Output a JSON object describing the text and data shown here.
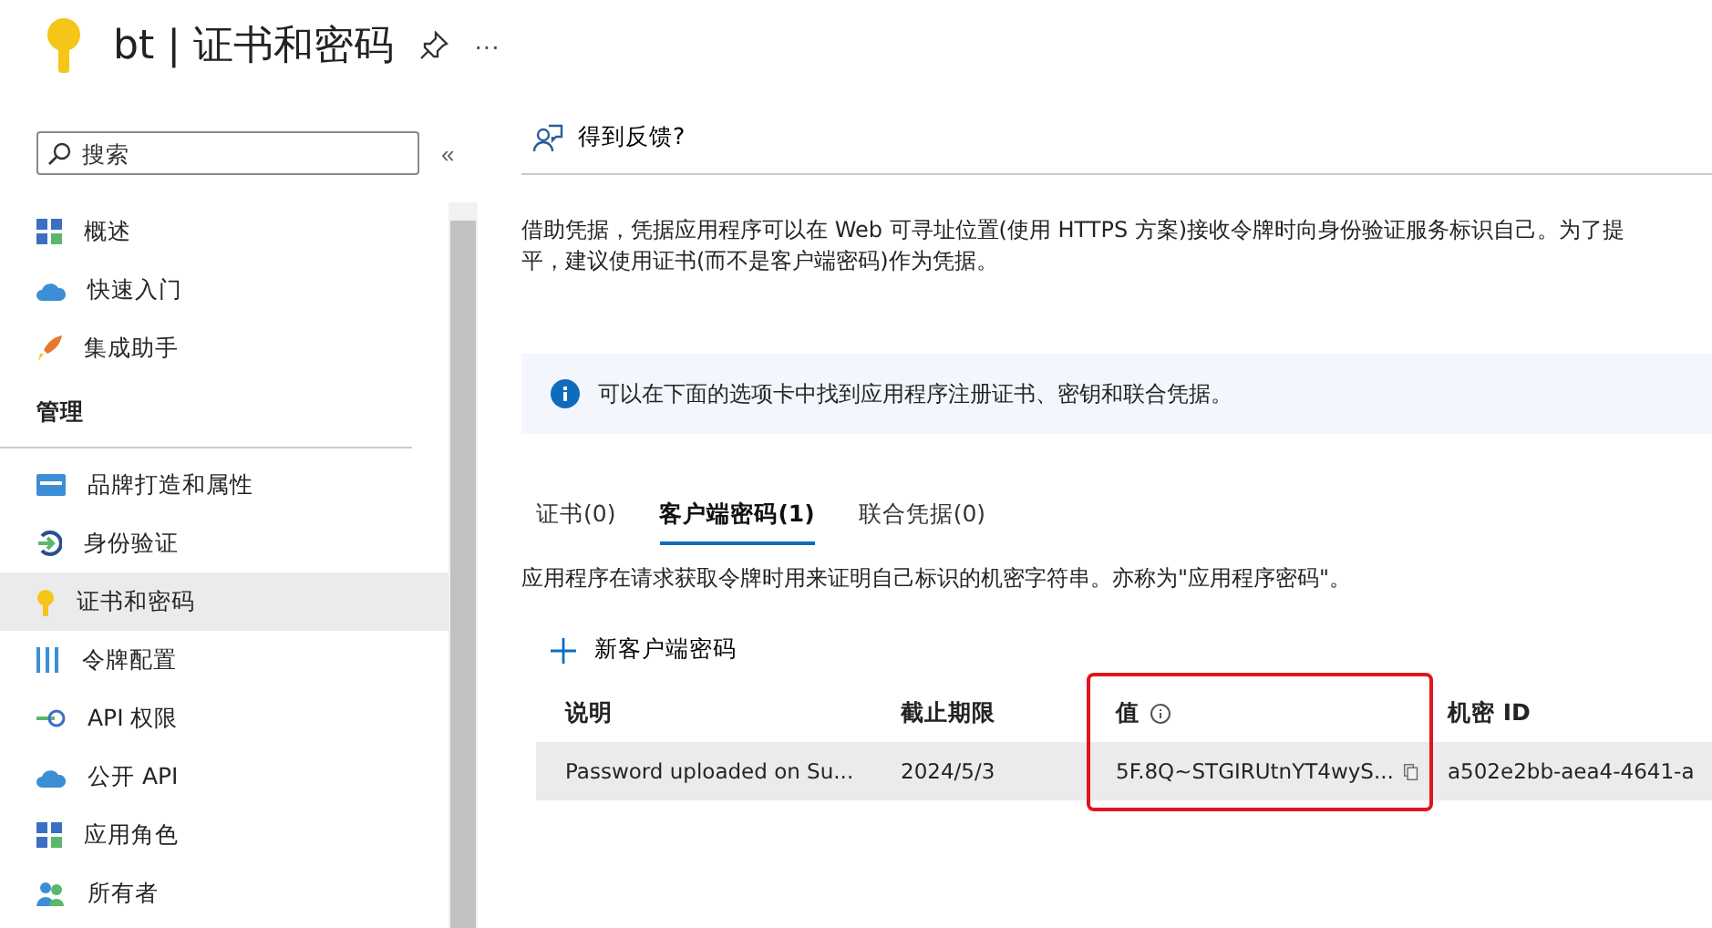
{
  "header": {
    "title": "bt | 证书和密码",
    "more": "···"
  },
  "sidebar": {
    "search": {
      "placeholder": "搜索"
    },
    "collapse": "«",
    "items": [
      {
        "kind": "item",
        "label": "概述",
        "selected": false
      },
      {
        "kind": "item",
        "label": "快速入门",
        "selected": false
      },
      {
        "kind": "item",
        "label": "集成助手",
        "selected": false
      },
      {
        "kind": "header",
        "label": "管理"
      },
      {
        "kind": "item",
        "label": "品牌打造和属性",
        "selected": false
      },
      {
        "kind": "item",
        "label": "身份验证",
        "selected": false
      },
      {
        "kind": "item",
        "label": "证书和密码",
        "selected": true
      },
      {
        "kind": "item",
        "label": "令牌配置",
        "selected": false
      },
      {
        "kind": "item",
        "label": "API 权限",
        "selected": false
      },
      {
        "kind": "item",
        "label": "公开 API",
        "selected": false
      },
      {
        "kind": "item",
        "label": "应用角色",
        "selected": false
      },
      {
        "kind": "item",
        "label": "所有者",
        "selected": false
      }
    ]
  },
  "toolbar": {
    "feedback": "得到反馈?"
  },
  "description": [
    "借助凭据，凭据应用程序可以在 Web 可寻址位置(使用 HTTPS 方案)接收令牌时向身份验证服务标识自己。为了提",
    "平，建议使用证书(而不是客户端密码)作为凭据。"
  ],
  "info_banner": "可以在下面的选项卡中找到应用程序注册证书、密钥和联合凭据。",
  "tabs": [
    {
      "label": "证书(0)",
      "selected": false
    },
    {
      "label": "客户端密码(1)",
      "selected": true
    },
    {
      "label": "联合凭据(0)",
      "selected": false
    }
  ],
  "tab_description": "应用程序在请求获取令牌时用来证明自己标识的机密字符串。亦称为\"应用程序密码\"。",
  "add_button": "新客户端密码",
  "table": {
    "columns": [
      "说明",
      "截止期限",
      "值",
      "机密 ID"
    ],
    "rows": [
      {
        "cells": [
          "Password uploaded on Su...",
          "2024/5/3",
          "5F.8Q~STGIRUtnYT4wyS...",
          "a502e2bb-aea4-4641-a"
        ],
        "selected": true
      }
    ]
  }
}
